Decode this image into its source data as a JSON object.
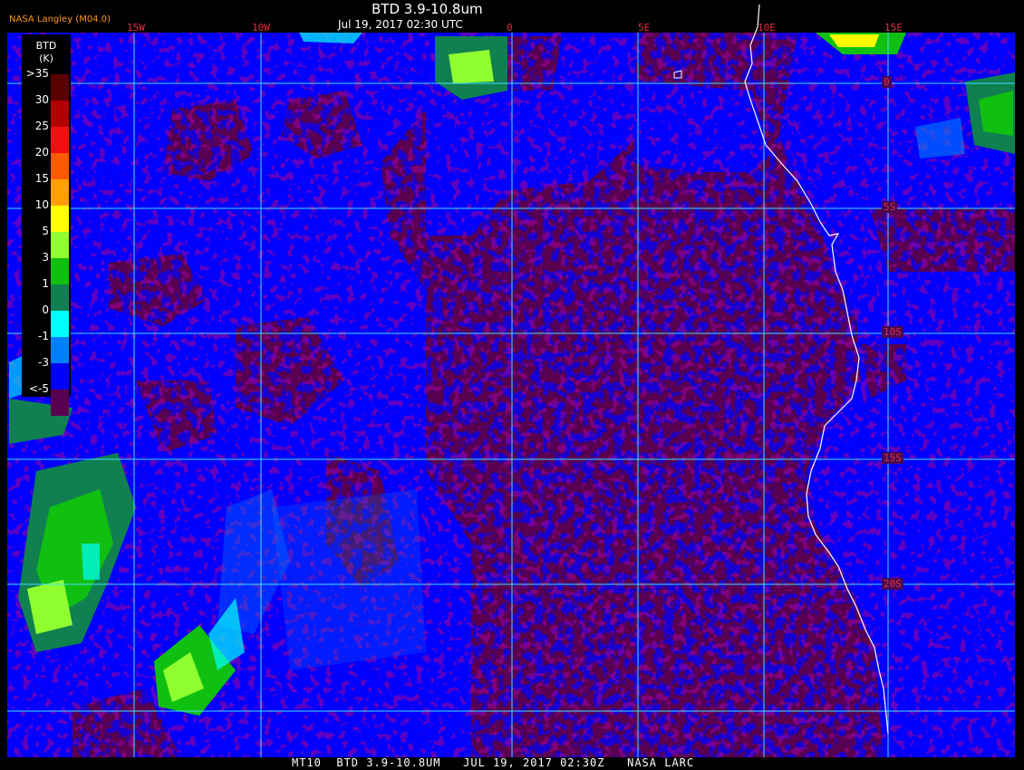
{
  "header": {
    "agency": "NASA Langley (M04.0)",
    "title": "BTD 3.9-10.8um",
    "subtitle": "Jul 19, 2017 02:30 UTC"
  },
  "footer": {
    "text": "MT10  BTD 3.9-10.8UM   JUL 19, 2017 02:30Z   NASA LARC"
  },
  "longitude_labels": [
    "15W",
    "10W",
    "0",
    "5E",
    "10E",
    "15E"
  ],
  "latitude_labels": [
    "0",
    "5S",
    "10S",
    "15S",
    "20S"
  ],
  "legend": {
    "title": "BTD",
    "units": "(K)",
    "ticks": [
      ">35",
      "30",
      "25",
      "20",
      "15",
      "10",
      "5",
      "3",
      "1",
      "0",
      "-1",
      "-3",
      "<-5"
    ],
    "colors": [
      "#5a0000",
      "#b00000",
      "#f01010",
      "#ff5a00",
      "#ffa000",
      "#ffff00",
      "#90ff30",
      "#10c010",
      "#108050",
      "#00ffff",
      "#0080ff",
      "#0000ff",
      "#58004f"
    ]
  },
  "colors": {
    "background_cloud_free": "#58004f",
    "low_btd": "#0000ff",
    "gridline": "#40e0ff",
    "coastline": "#ffffff",
    "label": "#e0303c"
  }
}
